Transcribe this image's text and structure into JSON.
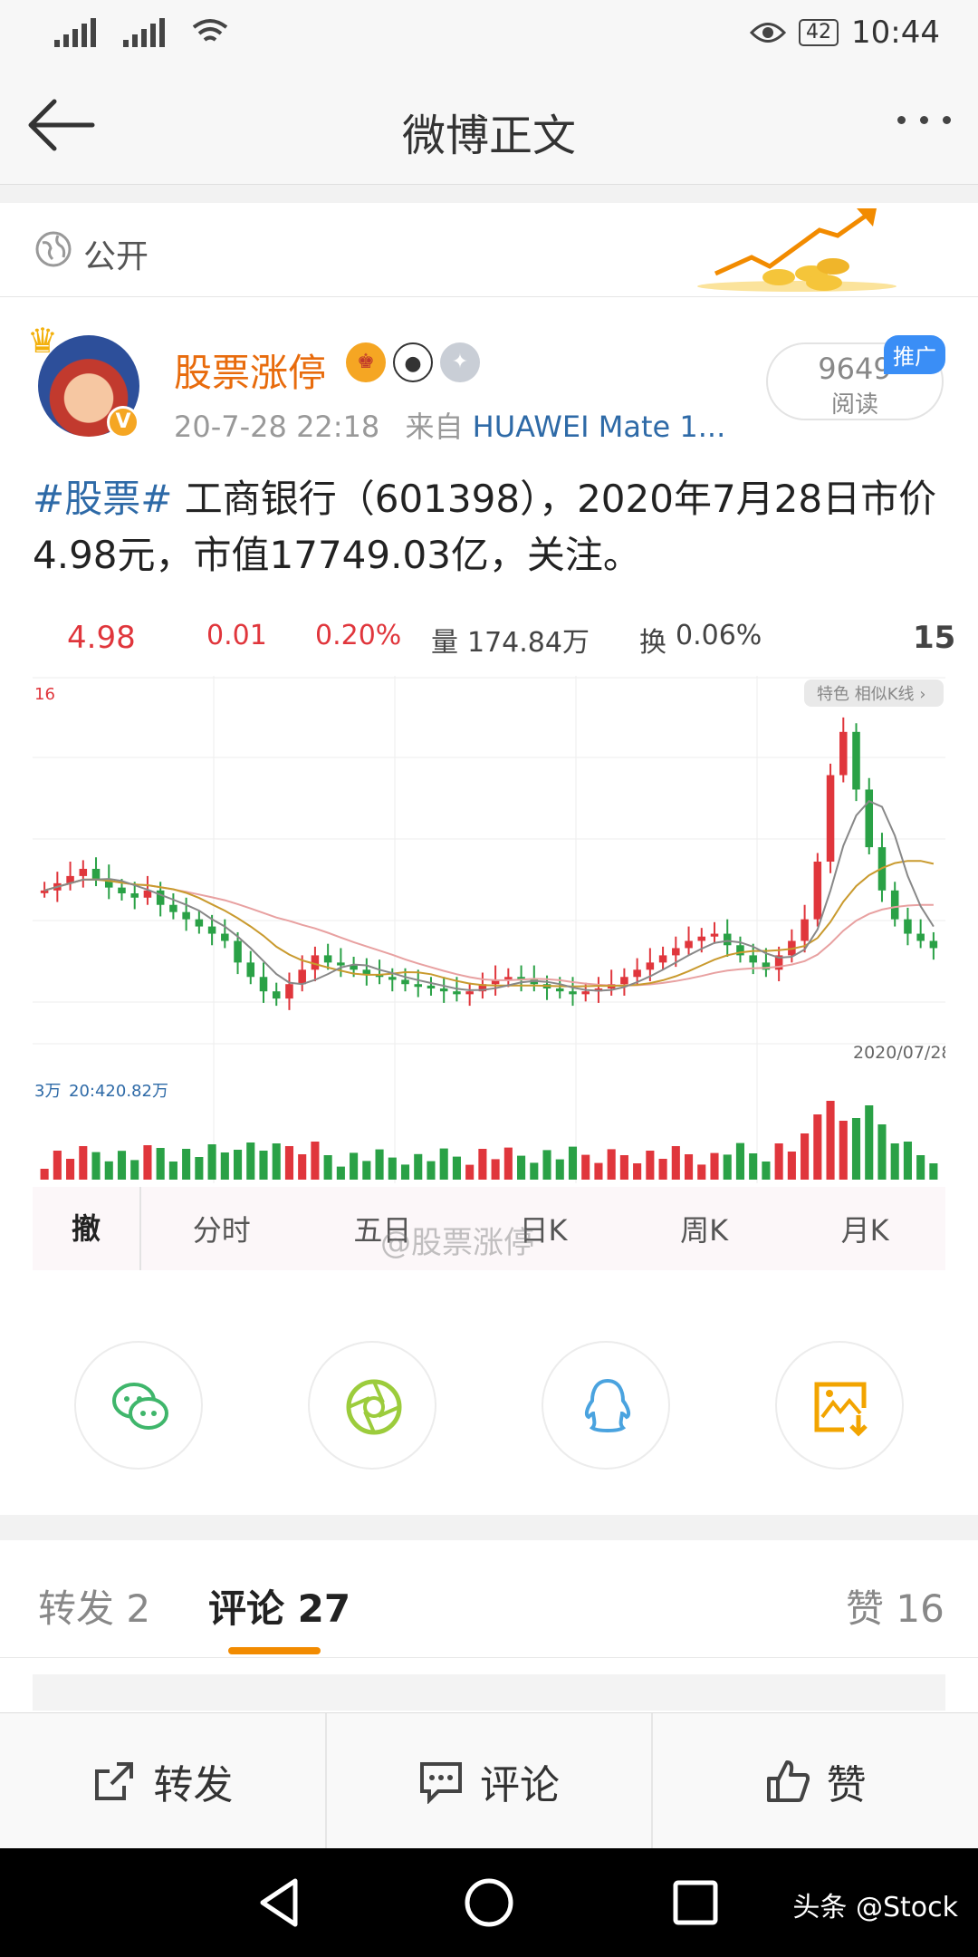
{
  "status_bar": {
    "battery": "42",
    "time": "10:44"
  },
  "navbar": {
    "title": "微博正文"
  },
  "visibility": {
    "label": "公开"
  },
  "author": {
    "name": "股票涨停",
    "meta_time": "20-7-28 22:18",
    "meta_from": "来自",
    "meta_source": "HUAWEI Mate 1...",
    "read_count": "9649",
    "read_label": "阅读",
    "promo_tag": "推广"
  },
  "post": {
    "hashtag": "#股票#",
    "body": " 工商银行（601398），2020年7月28日市价4.98元，市值17749.03亿，关注。"
  },
  "quote": {
    "price": "4.98",
    "change": "0.01",
    "change_pct": "0.20%",
    "volume_label": "量",
    "volume": "174.84万",
    "turnover_label": "换",
    "turnover": "0.06%",
    "edge": "15"
  },
  "chart_data": {
    "type": "candlestick",
    "badge": "特色  相似K线 ›",
    "ytick": "16",
    "date_label": "2020/07/28",
    "volume_axis_label": "3万",
    "volume_ma_label": "20:420.82万",
    "closes": [
      5.8,
      5.85,
      5.9,
      5.95,
      5.88,
      5.82,
      5.78,
      5.75,
      5.8,
      5.7,
      5.65,
      5.6,
      5.55,
      5.5,
      5.45,
      5.3,
      5.2,
      5.1,
      5.05,
      5.15,
      5.25,
      5.35,
      5.3,
      5.28,
      5.25,
      5.22,
      5.2,
      5.18,
      5.15,
      5.14,
      5.12,
      5.1,
      5.08,
      5.1,
      5.15,
      5.18,
      5.2,
      5.18,
      5.15,
      5.12,
      5.1,
      5.08,
      5.1,
      5.12,
      5.15,
      5.2,
      5.25,
      5.3,
      5.35,
      5.4,
      5.45,
      5.48,
      5.5,
      5.42,
      5.35,
      5.3,
      5.25,
      5.35,
      5.45,
      5.6,
      6.0,
      6.6,
      6.9,
      6.5,
      6.1,
      5.8,
      5.6,
      5.5,
      5.45,
      5.4
    ]
  },
  "tabs": {
    "items": [
      "撤",
      "分时",
      "五日",
      "日K",
      "周K",
      "月K"
    ],
    "watermark": "@股票涨停"
  },
  "comments_tabs": {
    "repost": "转发 2",
    "comment": "评论 27",
    "like": "赞 16"
  },
  "action_bar": {
    "repost": "转发",
    "comment": "评论",
    "like": "赞"
  },
  "system_watermark": "头条 @Stock"
}
